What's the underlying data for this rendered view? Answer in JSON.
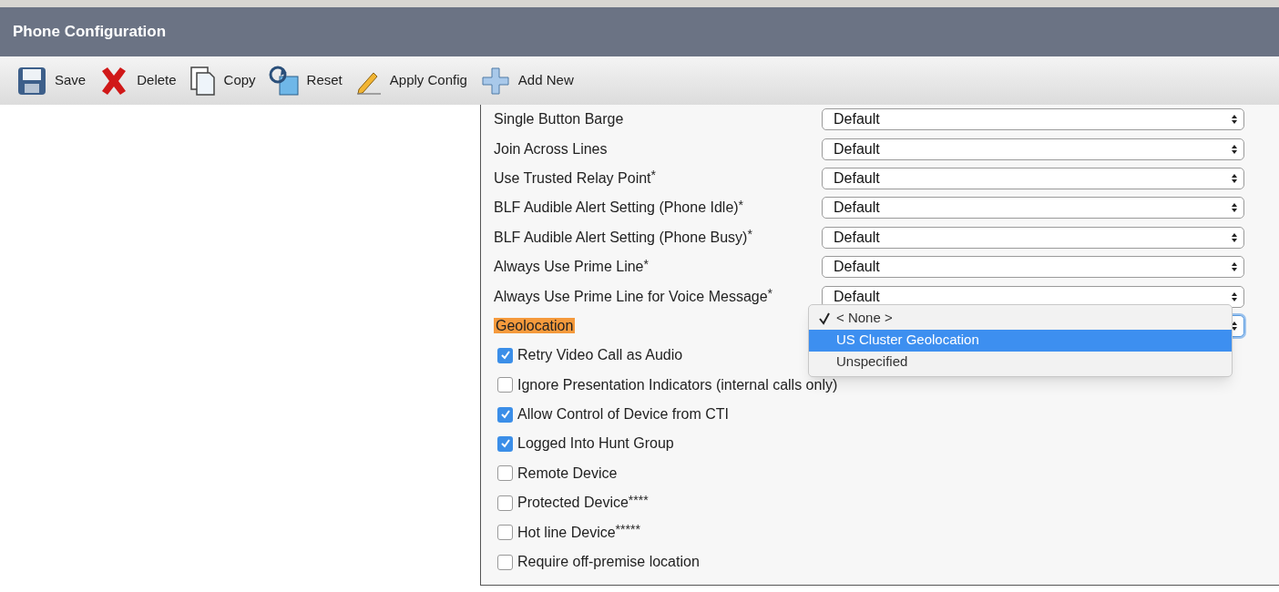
{
  "header": {
    "title": "Phone Configuration"
  },
  "toolbar": [
    {
      "kind": "save",
      "label": "Save"
    },
    {
      "kind": "delete",
      "label": "Delete"
    },
    {
      "kind": "copy",
      "label": "Copy"
    },
    {
      "kind": "reset",
      "label": "Reset"
    },
    {
      "kind": "apply",
      "label": "Apply Config"
    },
    {
      "kind": "add",
      "label": "Add New"
    }
  ],
  "settings": [
    {
      "kind": "select",
      "label": "Single Button Barge",
      "value": "Default"
    },
    {
      "kind": "select",
      "label": "Join Across Lines",
      "value": "Default"
    },
    {
      "kind": "select",
      "label": "Use Trusted Relay Point",
      "note_mark": "*",
      "value": "Default"
    },
    {
      "kind": "select",
      "label": "BLF Audible Alert Setting (Phone Idle)",
      "note_mark": "*",
      "value": "Default"
    },
    {
      "kind": "select",
      "label": "BLF Audible Alert Setting (Phone Busy)",
      "note_mark": "*",
      "value": "Default"
    },
    {
      "kind": "select",
      "label": "Always Use Prime Line",
      "note_mark": "*",
      "value": "Default"
    },
    {
      "kind": "select",
      "label": "Always Use Prime Line for Voice Message",
      "note_mark": "*",
      "value": "Default"
    },
    {
      "kind": "open-select",
      "label": "Geolocation",
      "highlighted": true,
      "options": [
        {
          "label": "< None >",
          "checked": true,
          "highlighted": false
        },
        {
          "label": "US Cluster Geolocation",
          "checked": false,
          "highlighted": true
        },
        {
          "label": "Unspecified",
          "checked": false,
          "highlighted": false
        }
      ]
    },
    {
      "kind": "checkbox",
      "label": "Retry Video Call as Audio",
      "checked": true
    },
    {
      "kind": "checkbox",
      "label": "Ignore Presentation Indicators (internal calls only)",
      "checked": false
    },
    {
      "kind": "checkbox",
      "label": "Allow Control of Device from CTI",
      "checked": true
    },
    {
      "kind": "checkbox",
      "label": "Logged Into Hunt Group",
      "checked": true
    },
    {
      "kind": "checkbox",
      "label": "Remote Device",
      "checked": false
    },
    {
      "kind": "checkbox",
      "label": "Protected Device",
      "note_mark": "****",
      "checked": false
    },
    {
      "kind": "checkbox",
      "label": "Hot line Device",
      "note_mark": "*****",
      "checked": false
    },
    {
      "kind": "checkbox",
      "label": "Require off-premise location",
      "checked": false
    }
  ]
}
